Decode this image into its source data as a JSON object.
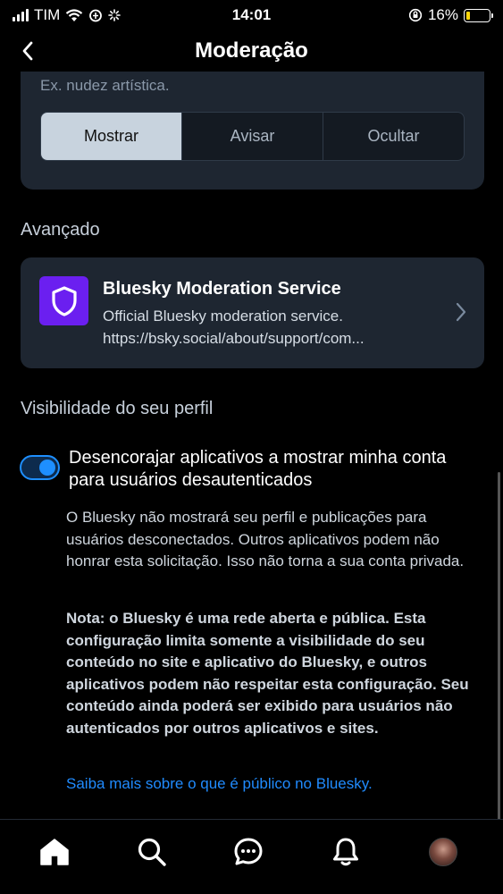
{
  "status_bar": {
    "carrier": "TIM",
    "time": "14:01",
    "battery_percent": "16%",
    "battery_level": 0.16
  },
  "nav": {
    "title": "Moderação",
    "back_icon": "chevron-left-icon"
  },
  "content_filter": {
    "hint": "Ex. nudez artística.",
    "options": [
      "Mostrar",
      "Avisar",
      "Ocultar"
    ],
    "selected": "Mostrar"
  },
  "advanced": {
    "title": "Avançado",
    "service": {
      "name": "Bluesky Moderation Service",
      "description": "Official Bluesky moderation service.",
      "url": "https://bsky.social/about/support/com..."
    }
  },
  "profile_visibility": {
    "title": "Visibilidade do seu perfil",
    "toggle_on": true,
    "toggle_label": "Desencorajar aplicativos a mostrar minha conta para usuários desautenticados",
    "paragraph": "O Bluesky não mostrará seu perfil e publicações para usuários desconectados. Outros aplicativos podem não honrar esta solicitação. Isso não torna a sua conta privada.",
    "note": "Nota: o Bluesky é uma rede aberta e pública. Esta configuração limita somente a visibilidade do seu conteúdo no site e aplicativo do Bluesky, e outros aplicativos podem não respeitar esta configuração. Seu conteúdo ainda poderá ser exibido para usuários não autenticados por outros aplicativos e sites.",
    "link": "Saiba mais sobre o que é público no Bluesky."
  },
  "tabbar": {
    "items": [
      "home-icon",
      "search-icon",
      "chat-icon",
      "bell-icon",
      "profile-avatar"
    ]
  },
  "colors": {
    "accent": "#208bfe",
    "card": "#1e2631",
    "brand_purple": "#6b1ff0",
    "battery": "#ffd60a"
  }
}
